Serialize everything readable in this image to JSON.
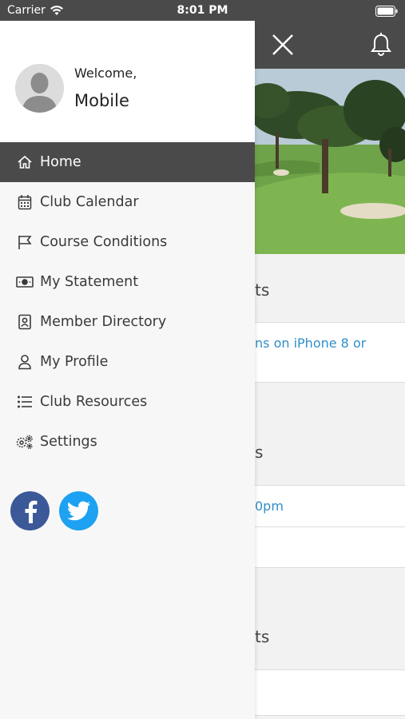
{
  "status_bar": {
    "carrier": "Carrier",
    "time": "8:01 PM"
  },
  "background": {
    "sections": [
      {
        "title": "ts",
        "row_text": "ns on iPhone 8 or"
      },
      {
        "title": "s",
        "row_text": "0pm"
      },
      {
        "title": "ts",
        "row_text": ""
      }
    ]
  },
  "drawer": {
    "welcome": "Welcome,",
    "user_name": "Mobile",
    "menu": [
      {
        "label": "Home",
        "icon": "home-icon"
      },
      {
        "label": "Club Calendar",
        "icon": "calendar-icon"
      },
      {
        "label": "Course Conditions",
        "icon": "flag-icon"
      },
      {
        "label": "My Statement",
        "icon": "money-icon"
      },
      {
        "label": "Member Directory",
        "icon": "contact-card-icon"
      },
      {
        "label": "My Profile",
        "icon": "person-icon"
      },
      {
        "label": "Club Resources",
        "icon": "list-icon"
      },
      {
        "label": "Settings",
        "icon": "gears-icon"
      }
    ],
    "social": [
      "facebook-icon",
      "twitter-icon"
    ]
  },
  "colors": {
    "header": "#4a4a4a",
    "link": "#2f8fc8",
    "facebook": "#3b5998",
    "twitter": "#1da1f2"
  }
}
